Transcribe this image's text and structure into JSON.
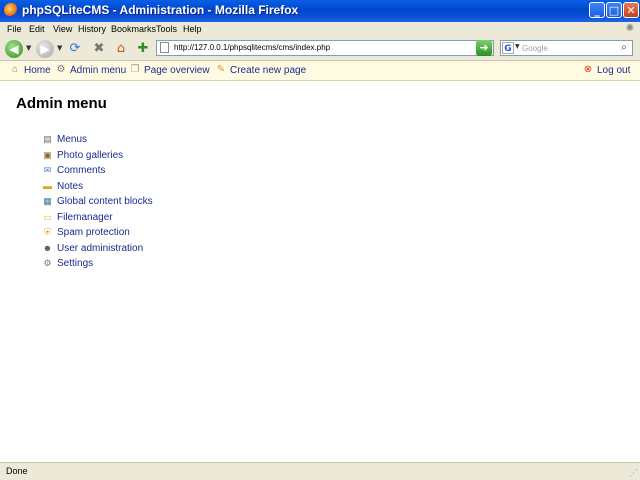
{
  "window": {
    "title": "phpSQLiteCMS - Administration - Mozilla Firefox"
  },
  "menu": [
    "File",
    "Edit",
    "View",
    "History",
    "Bookmarks",
    "Tools",
    "Help"
  ],
  "address": {
    "url": "http://127.0.0.1/phpsqlitecms/cms/index.php"
  },
  "search": {
    "placeholder": "Google",
    "engine_glyph": "G"
  },
  "cms_toolbar": {
    "home": "Home",
    "admin_menu": "Admin menu",
    "page_overview": "Page overview",
    "create_new_page": "Create new page",
    "log_out": "Log out"
  },
  "page": {
    "title": "Admin menu",
    "items": [
      "Menus",
      "Photo galleries",
      "Comments",
      "Notes",
      "Global content blocks",
      "Filemanager",
      "Spam protection",
      "User administration",
      "Settings"
    ]
  },
  "status": {
    "text": "Done"
  },
  "colors": {
    "link": "#1a2c8c",
    "toolbar_bg": "#fffbe2",
    "title_bar": "#0a4cd6"
  }
}
